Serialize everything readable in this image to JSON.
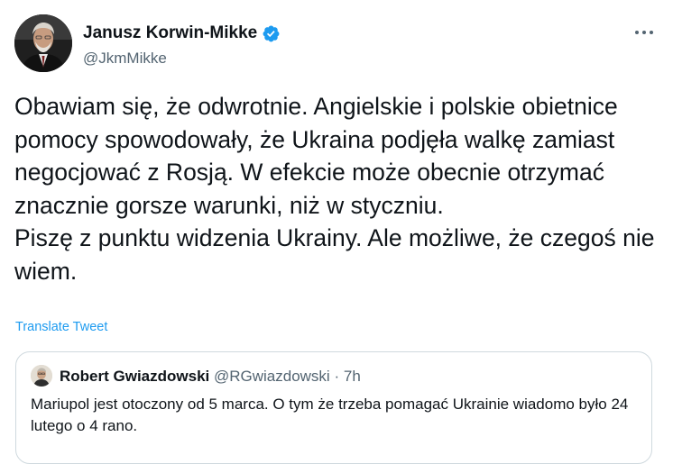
{
  "author": {
    "name": "Janusz Korwin-Mikke",
    "handle": "@JkmMikke",
    "verified_icon": "verified-badge-icon",
    "verified_color": "#1d9bf0"
  },
  "more_icon": "more-horizontal-icon",
  "tweet": {
    "text": "Obawiam się, że odwrotnie. Angielskie i polskie obietnice pomocy spowodowały, że Ukraina podjęła walkę zamiast negocjować z Rosją. W efekcie może obecnie otrzymać znacznie gorsze warunki, niż w styczniu.\nPiszę z punktu widzenia Ukrainy. Ale możliwe, że czegoś nie wiem.",
    "translate_label": "Translate Tweet"
  },
  "quote": {
    "name": "Robert Gwiazdowski",
    "handle": "@RGwiazdowski",
    "separator": "·",
    "time": "7h",
    "text": "Mariupol jest otoczony od 5 marca. O tym że trzeba pomagać Ukrainie wiadomo było 24 lutego o 4 rano."
  },
  "colors": {
    "link": "#1d9bf0",
    "secondary_text": "#536471",
    "border": "#cfd9de"
  }
}
